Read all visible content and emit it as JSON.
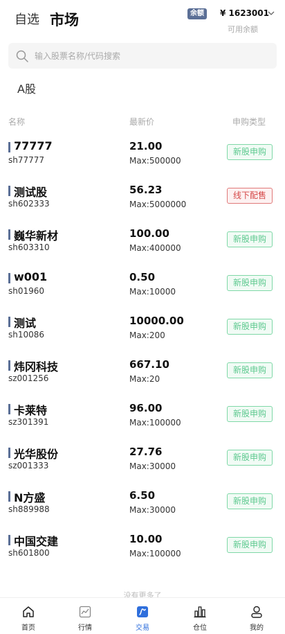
{
  "header": {
    "tab_watchlist": "自选",
    "tab_market": "市场",
    "balance_badge": "余额",
    "balance_value": "¥ 1623001",
    "balance_label": "可用余额"
  },
  "search": {
    "placeholder": "输入股票名称/代码搜索"
  },
  "market_tab": "A股",
  "columns": {
    "name": "名称",
    "price": "最新价",
    "type": "申购类型"
  },
  "rows": [
    {
      "name": "77777",
      "code": "sh77777",
      "price": "21.00",
      "max": "Max:500000",
      "type": "新股申购",
      "variant": "green"
    },
    {
      "name": "测试股",
      "code": "sh602333",
      "price": "56.23",
      "max": "Max:5000000",
      "type": "线下配售",
      "variant": "red"
    },
    {
      "name": "巍华新材",
      "code": "sh603310",
      "price": "100.00",
      "max": "Max:400000",
      "type": "新股申购",
      "variant": "green"
    },
    {
      "name": "w001",
      "code": "sh01960",
      "price": "0.50",
      "max": "Max:10000",
      "type": "新股申购",
      "variant": "green"
    },
    {
      "name": "测试",
      "code": "sh10086",
      "price": "10000.00",
      "max": "Max:200",
      "type": "新股申购",
      "variant": "green"
    },
    {
      "name": "炜冈科技",
      "code": "sz001256",
      "price": "667.10",
      "max": "Max:20",
      "type": "新股申购",
      "variant": "green"
    },
    {
      "name": "卡莱特",
      "code": "sz301391",
      "price": "96.00",
      "max": "Max:100000",
      "type": "新股申购",
      "variant": "green"
    },
    {
      "name": "光华股份",
      "code": "sz001333",
      "price": "27.76",
      "max": "Max:30000",
      "type": "新股申购",
      "variant": "green"
    },
    {
      "name": "N方盛",
      "code": "sh889988",
      "price": "6.50",
      "max": "Max:30000",
      "type": "新股申购",
      "variant": "green"
    },
    {
      "name": "中国交建",
      "code": "sh601800",
      "price": "10.00",
      "max": "Max:100000",
      "type": "新股申购",
      "variant": "green"
    }
  ],
  "no_more": "没有更多了",
  "tabbar": {
    "items": [
      {
        "label": "首页",
        "icon": "home-icon"
      },
      {
        "label": "行情",
        "icon": "chart-icon"
      },
      {
        "label": "交易",
        "icon": "trade-icon",
        "active": true
      },
      {
        "label": "仓位",
        "icon": "bars-icon"
      },
      {
        "label": "我的",
        "icon": "user-icon"
      }
    ]
  },
  "colors": {
    "accent": "#2f6fdc",
    "badge": "#5b6f96",
    "green_tag": "#5dc98f",
    "red_tag": "#d54848"
  }
}
